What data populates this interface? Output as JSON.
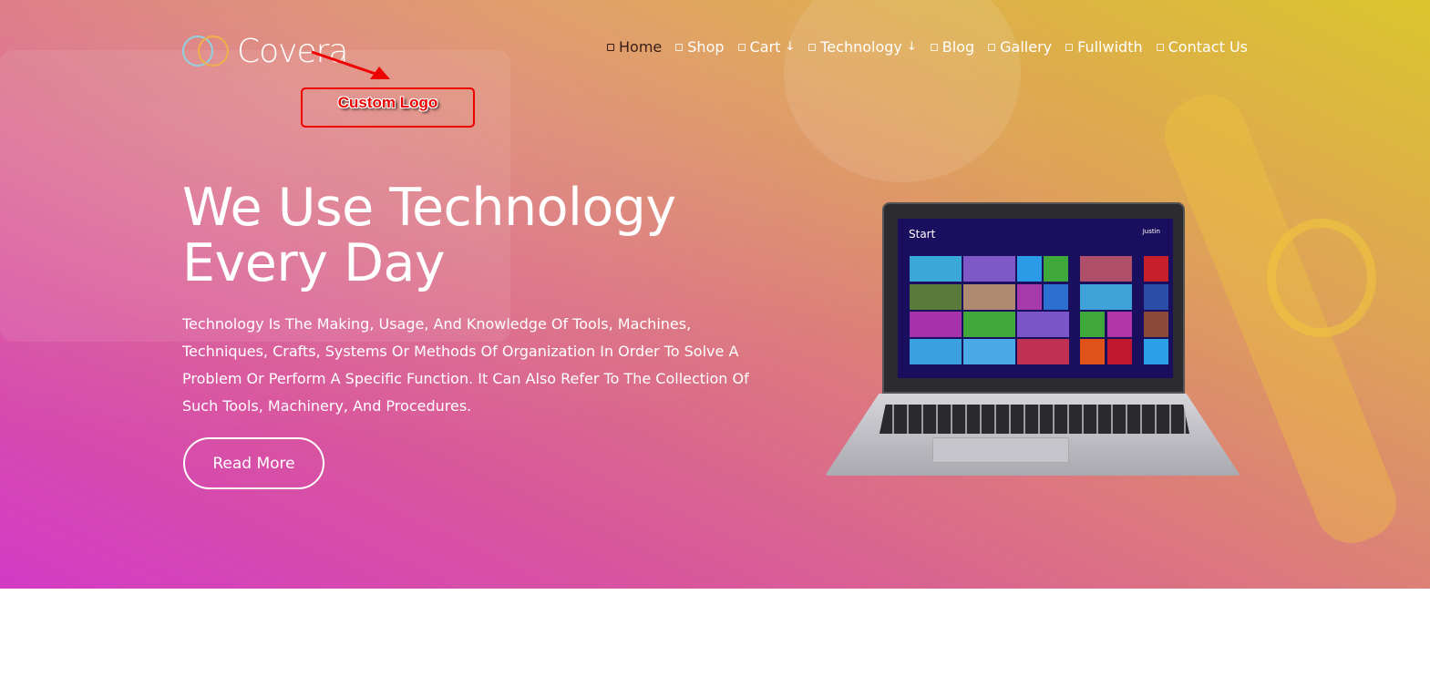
{
  "brand": {
    "name": "Covera",
    "ring_colors": [
      "#8fd3e0",
      "#f0b04a"
    ]
  },
  "annotation": {
    "label": "Custom Logo",
    "color": "#e00000"
  },
  "nav": {
    "items": [
      {
        "label": "Home",
        "active": true,
        "dropdown": false
      },
      {
        "label": "Shop",
        "active": false,
        "dropdown": false
      },
      {
        "label": "Cart",
        "active": false,
        "dropdown": true
      },
      {
        "label": "Technology",
        "active": false,
        "dropdown": true
      },
      {
        "label": "Blog",
        "active": false,
        "dropdown": false
      },
      {
        "label": "Gallery",
        "active": false,
        "dropdown": false
      },
      {
        "label": "Fullwidth",
        "active": false,
        "dropdown": false
      },
      {
        "label": "Contact Us",
        "active": false,
        "dropdown": false
      }
    ],
    "dropdown_glyph": "↓"
  },
  "hero": {
    "title_line1": "We Use Technology",
    "title_line2": "Every Day",
    "description": "Technology Is The Making, Usage, And Knowledge Of Tools, Machines, Techniques, Crafts, Systems Or Methods Of Organization In Order To Solve A Problem Or Perform A Specific Function. It Can Also Refer To The Collection Of Such Tools, Machinery, And Procedures.",
    "button": "Read More"
  },
  "laptop_screen": {
    "title": "Start",
    "user": "Justin"
  }
}
